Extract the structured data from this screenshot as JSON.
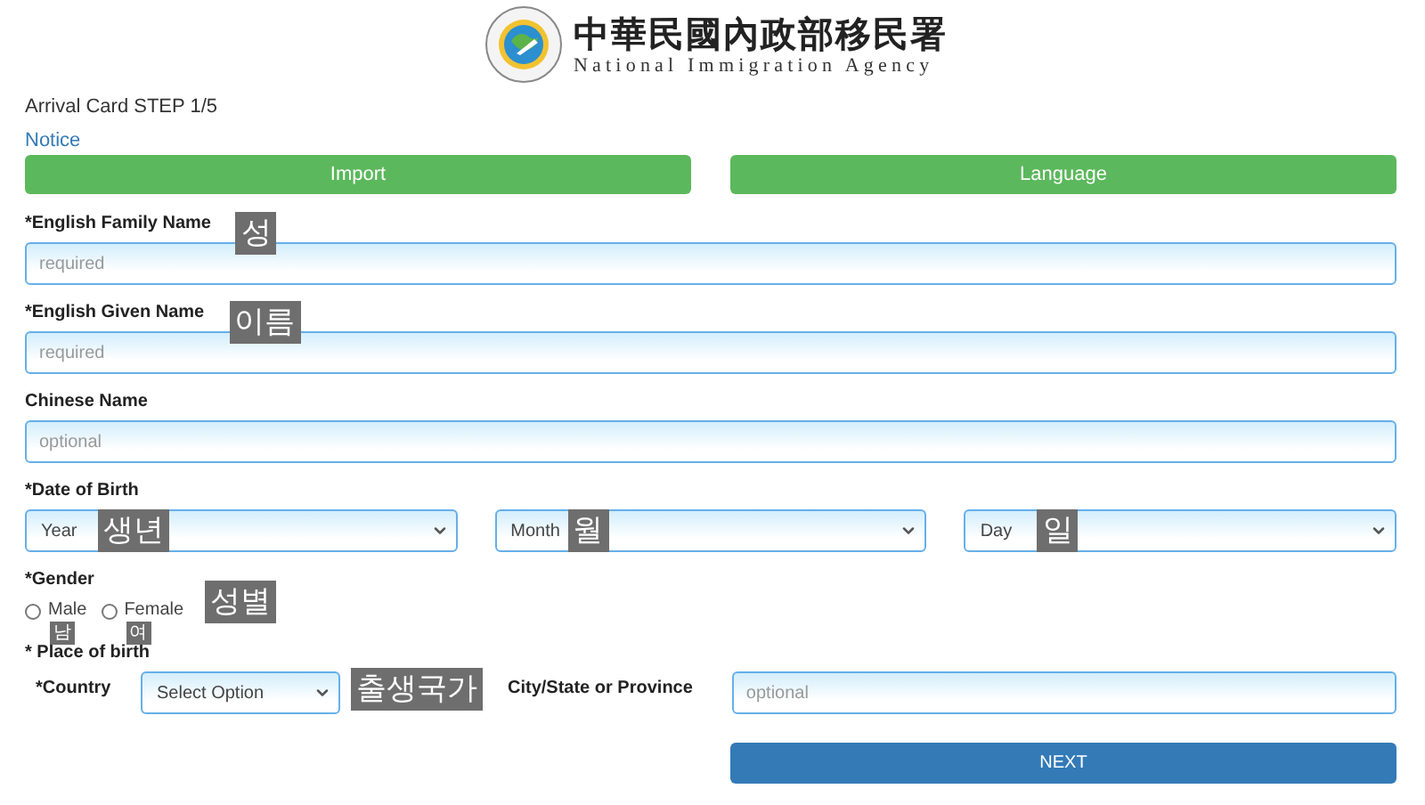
{
  "header": {
    "title_zh": "中華民國內政部移民署",
    "title_en": "National Immigration Agency"
  },
  "step": "Arrival Card STEP 1/5",
  "notice": "Notice",
  "top_buttons": [
    "Import",
    "Language"
  ],
  "fields": [
    {
      "label": "*English Family Name",
      "placeholder": "required",
      "annotation": "성"
    },
    {
      "label": "*English Given Name",
      "placeholder": "required",
      "annotation": "이름"
    },
    {
      "label": "Chinese Name",
      "placeholder": "optional"
    }
  ],
  "date_of_birth": {
    "label": "*Date of Birth",
    "selects": [
      {
        "value": "Year",
        "annotation": "생년"
      },
      {
        "value": "Month",
        "annotation": "월"
      },
      {
        "value": "Day",
        "annotation": "일"
      }
    ]
  },
  "gender": {
    "label": "*Gender",
    "annotation": "성별",
    "options": [
      {
        "label": "Male",
        "selected": false,
        "annotation": "남"
      },
      {
        "label": "Female",
        "selected": false,
        "annotation": "여"
      }
    ]
  },
  "place_of_birth": {
    "label": "* Place of birth",
    "country": {
      "label": "*Country",
      "value": "Select Option",
      "annotation": "출생국가"
    },
    "city": {
      "label": "City/State or Province",
      "placeholder": "optional"
    }
  },
  "next_button": "NEXT"
}
